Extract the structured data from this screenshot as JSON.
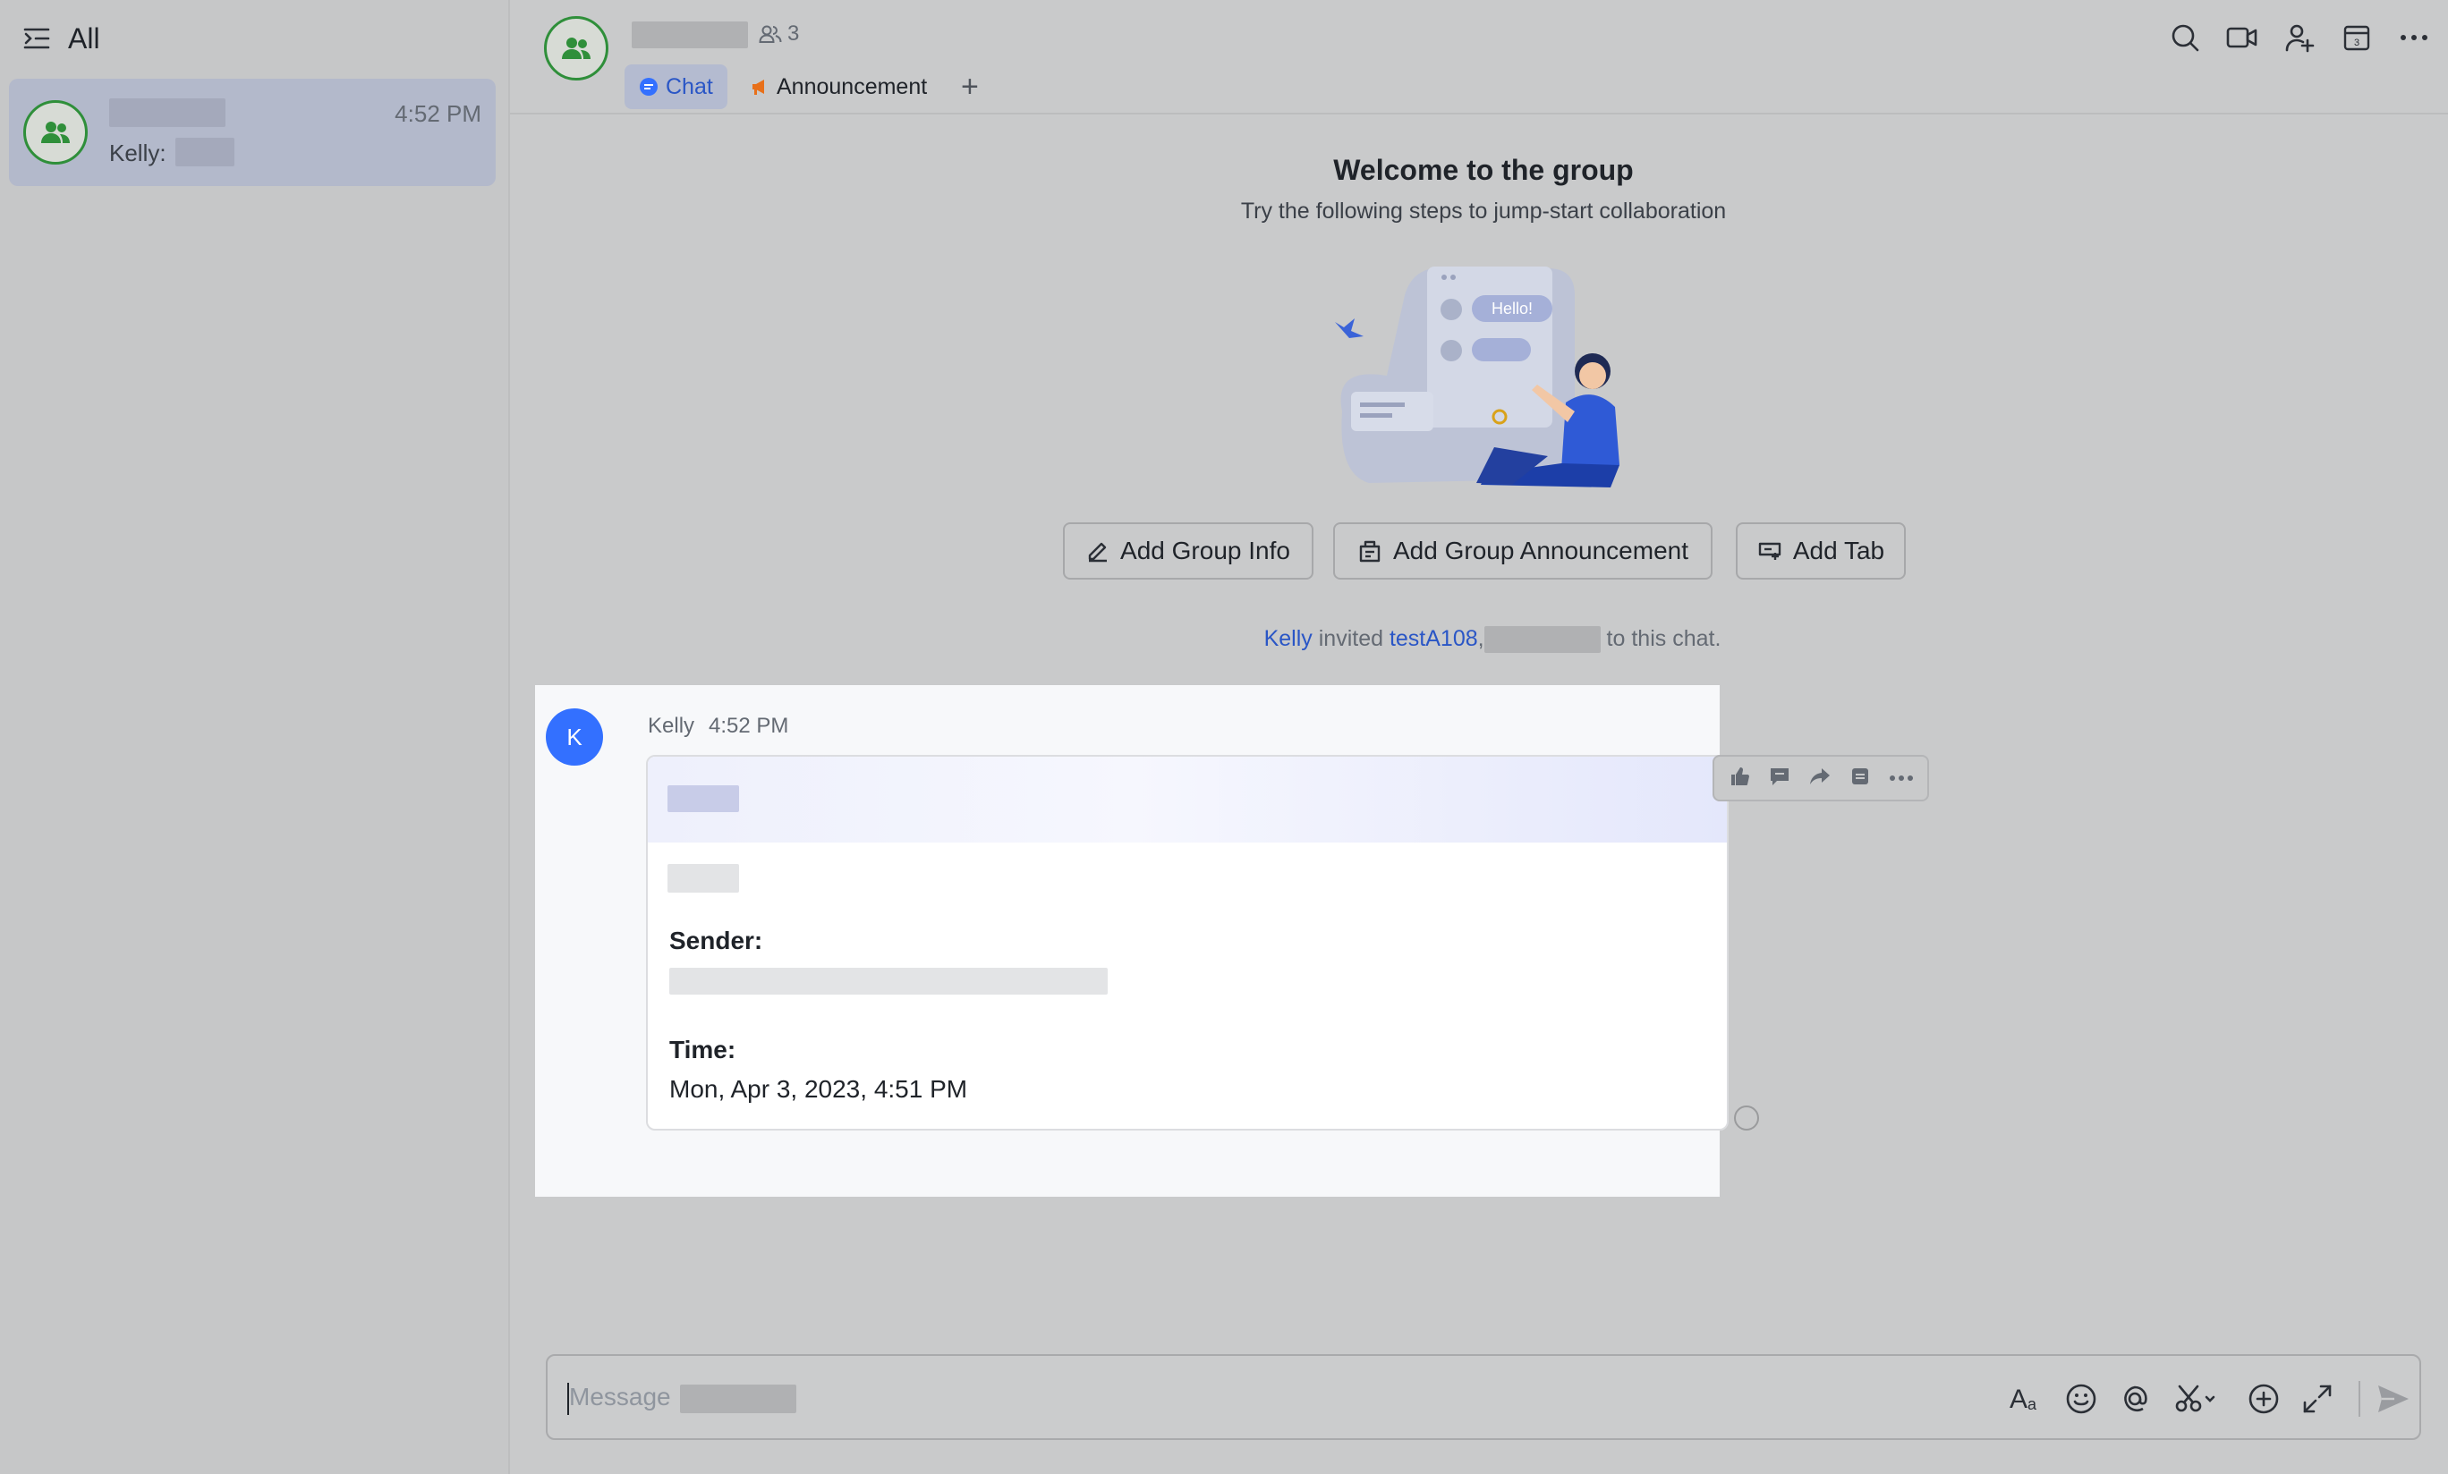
{
  "sidebar": {
    "title": "All",
    "chat_item": {
      "time": "4:52 PM",
      "preview_sender": "Kelly:"
    }
  },
  "header": {
    "member_count": "3",
    "tabs": [
      {
        "label": "Chat"
      },
      {
        "label": "Announcement"
      }
    ],
    "add_tab_symbol": "+"
  },
  "welcome": {
    "title": "Welcome to the group",
    "subtitle": "Try the following steps to jump-start collaboration",
    "illustration_text": "Hello!",
    "buttons": {
      "add_group_info": "Add Group Info",
      "add_group_announcement": "Add Group Announcement",
      "add_tab": "Add Tab"
    }
  },
  "system_message": {
    "inviter": "Kelly",
    "verb": "invited",
    "invitee": "testA108",
    "separator": ",",
    "suffix": "to this chat."
  },
  "message": {
    "avatar_initial": "K",
    "sender": "Kelly",
    "time": "4:52 PM",
    "card": {
      "sender_label": "Sender:",
      "time_label": "Time:",
      "time_value": "Mon, Apr 3, 2023, 4:51 PM"
    }
  },
  "composer": {
    "placeholder": "Message"
  },
  "colors": {
    "accent_blue": "#3370ff",
    "link_blue": "#2a56c6",
    "group_green": "#2f8f3a",
    "announcement_orange": "#e8701a"
  }
}
